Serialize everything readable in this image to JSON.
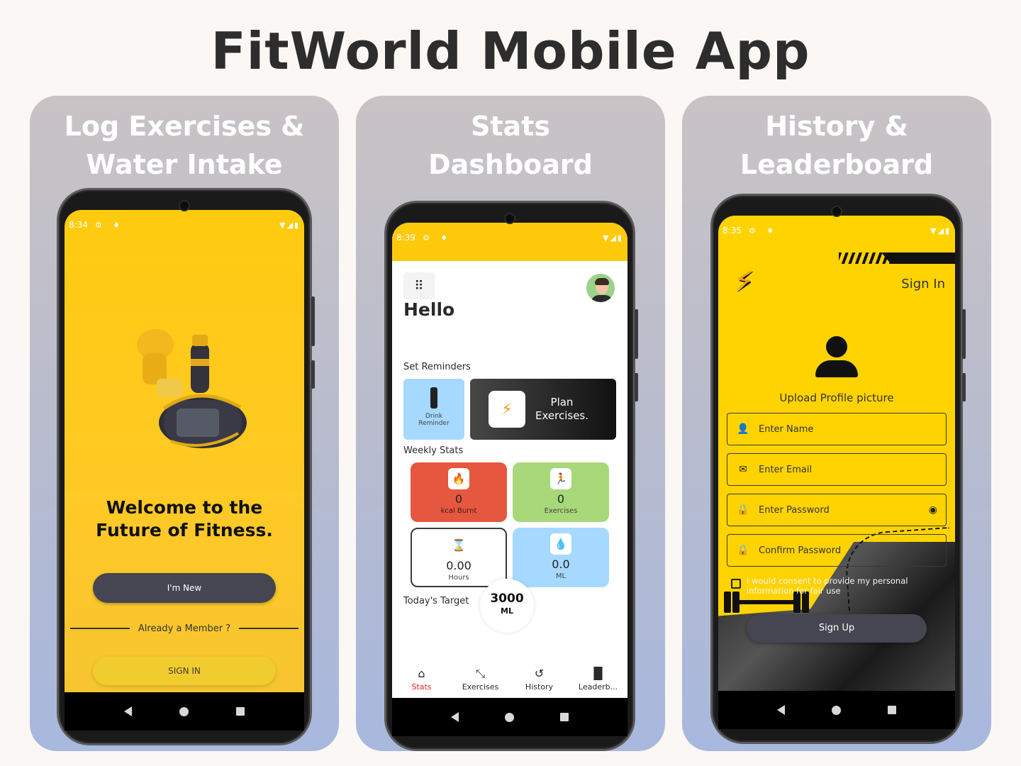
{
  "page": {
    "title": "FitWorld Mobile App"
  },
  "panels": {
    "p1": {
      "caption_line1": "Log Exercises &",
      "caption_line2": "Water Intake",
      "status": {
        "time": "8:34",
        "left_icons": "⚙ ♦",
        "right_icons": "▼◢▮"
      },
      "welcome_line1": "Welcome to the",
      "welcome_line2": "Future of Fitness.",
      "btn_new": "I'm New",
      "member_text": "Already a Member ?",
      "btn_signin": "SIGN IN"
    },
    "p2": {
      "caption_line1": "Stats",
      "caption_line2": "Dashboard",
      "status": {
        "time": "8:39",
        "left_icons": "⚙ ♦",
        "right_icons": "▼◢▮"
      },
      "hello": "Hello",
      "menu_icon": "⠿",
      "set_reminders": "Set Reminders",
      "drink_line1": "Drink",
      "drink_line2": "Reminder",
      "plan_line1": "Plan",
      "plan_line2": "Exercises.",
      "plan_logo": "⚡",
      "weekly_stats": "Weekly Stats",
      "stats": {
        "kcal": {
          "icon": "🔥",
          "value": "0",
          "label": "kcal Burnt"
        },
        "exercises": {
          "icon": "🏃",
          "value": "0",
          "label": "Exercises"
        },
        "hours": {
          "icon": "⌛",
          "value": "0.00",
          "label": "Hours"
        },
        "ml": {
          "icon": "💧",
          "value": "0.0",
          "label": "ML"
        }
      },
      "todays_target": "Today's Target",
      "target_value": "3000",
      "target_unit": "ML",
      "nav": [
        {
          "icon": "⌂",
          "label": "Stats"
        },
        {
          "icon": "⤡",
          "label": "Exercises"
        },
        {
          "icon": "↺",
          "label": "History"
        },
        {
          "icon": "▐▌",
          "label": "Leaderb..."
        }
      ]
    },
    "p3": {
      "caption_line1": "History &",
      "caption_line2": "Leaderboard",
      "status": {
        "time": "8:35",
        "left_icons": "⚙ ♦",
        "right_icons": "▼◢▮"
      },
      "brand_logo": "⚡",
      "sign_in": "Sign In",
      "upload_label": "Upload Profile picture",
      "fields": {
        "name": {
          "icon": "👤",
          "placeholder": "Enter Name"
        },
        "email": {
          "icon": "✉",
          "placeholder": "Enter Email"
        },
        "password": {
          "icon": "🔒",
          "placeholder": "Enter Password",
          "eye": "◉"
        },
        "confirm": {
          "icon": "🔒",
          "placeholder": "Confirm Password"
        }
      },
      "consent": "I would consent to provide my personal information for fair use",
      "btn_signup": "Sign Up"
    }
  },
  "colors": {
    "brand_yellow": "#ffcb0f",
    "dark_button": "#454651",
    "active_nav": "#e02424"
  }
}
